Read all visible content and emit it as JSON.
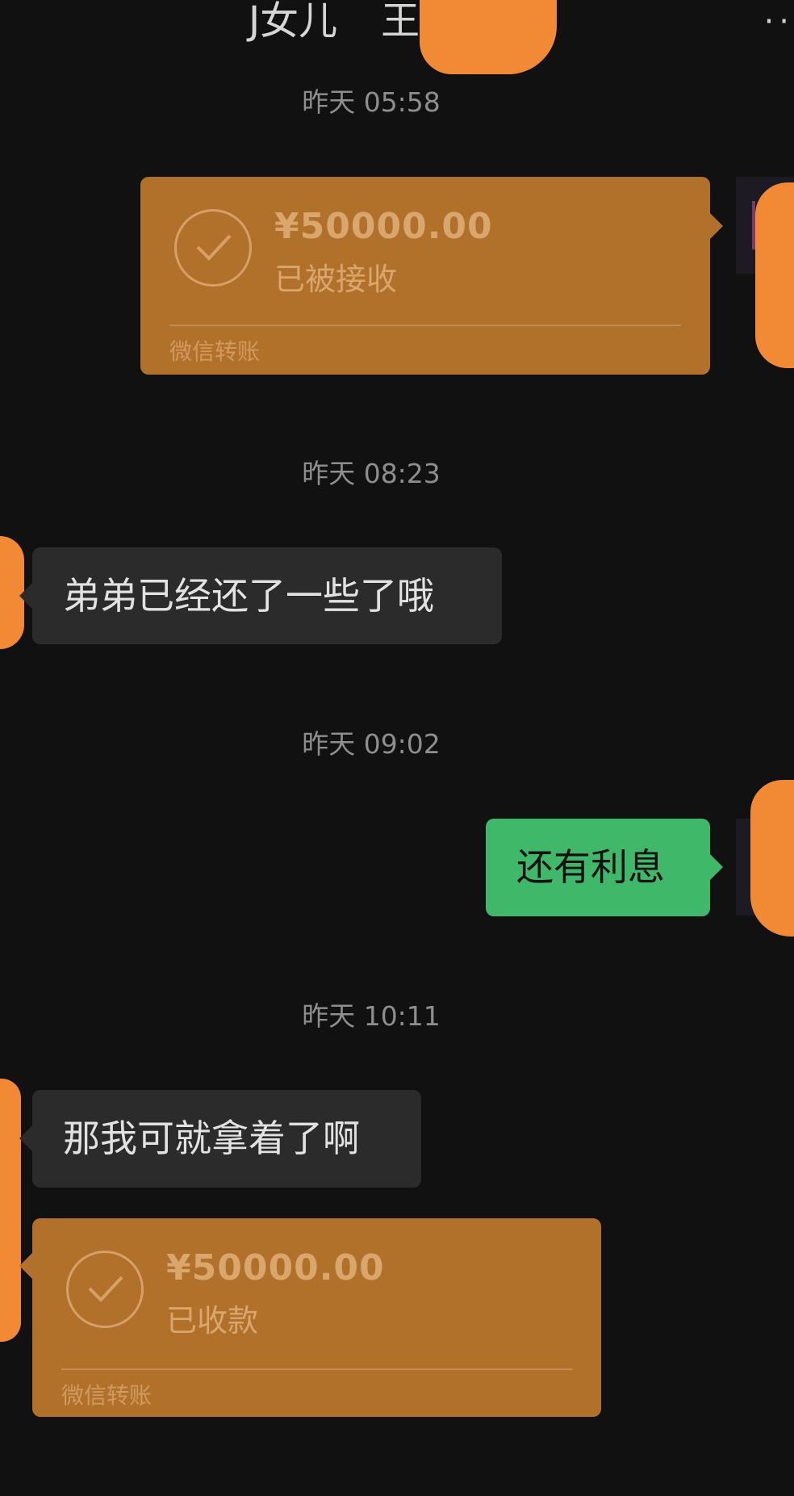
{
  "header": {
    "title": "J女儿",
    "title_extra": "王",
    "more_icon": "more-dots-icon"
  },
  "messages": [
    {
      "timestamp": "昨天 05:58"
    },
    {
      "transfer_out": {
        "amount": "¥50000.00",
        "status": "已被接收",
        "footer": "微信转账"
      }
    },
    {
      "timestamp": "昨天 08:23"
    },
    {
      "text_in": "弟弟已经还了一些了哦"
    },
    {
      "timestamp": "昨天 09:02"
    },
    {
      "text_out": "还有利息"
    },
    {
      "timestamp": "昨天 10:11"
    },
    {
      "text_in": "那我可就拿着了啊"
    },
    {
      "transfer_in": {
        "amount": "¥50000.00",
        "status": "已收款",
        "footer": "微信转账"
      }
    }
  ],
  "colors": {
    "background": "#111111",
    "transfer_card": "#b2712a",
    "incoming_bubble": "#2b2b2b",
    "outgoing_bubble": "#3fb86a",
    "redaction": "#f28a35"
  }
}
